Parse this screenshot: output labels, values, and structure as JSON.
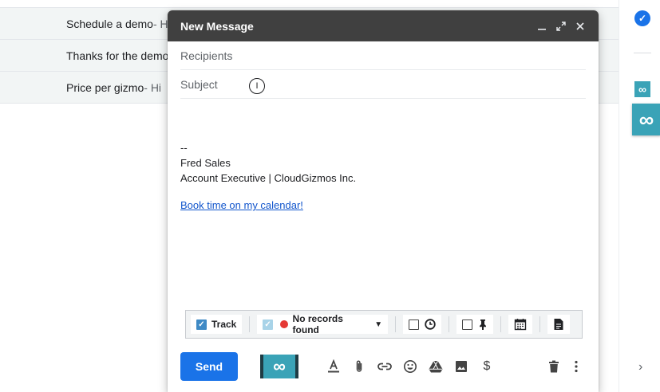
{
  "email_list": [
    {
      "subject": "Schedule a demo",
      "snippet": " - Hi"
    },
    {
      "subject": "Thanks for the demo",
      "snippet": ""
    },
    {
      "subject": "Price per gizmo",
      "snippet": " - Hi"
    }
  ],
  "compose": {
    "title": "New Message",
    "header_icons": [
      "minimize-icon",
      "expand-icon",
      "close-icon"
    ],
    "recipients_placeholder": "Recipients",
    "subject_placeholder": "Subject",
    "signature": {
      "separator": "--",
      "name": "Fred Sales",
      "role": "Account Executive | CloudGizmos Inc."
    },
    "calendar_link": "Book time on my calendar!",
    "toolbar": {
      "track_label": "Track",
      "records_label": "No records found",
      "status_color": "#e53935"
    },
    "send_label": "Send"
  },
  "colors": {
    "accent": "#1a73e8",
    "extension": "#3aa3b7",
    "header": "#404040"
  }
}
